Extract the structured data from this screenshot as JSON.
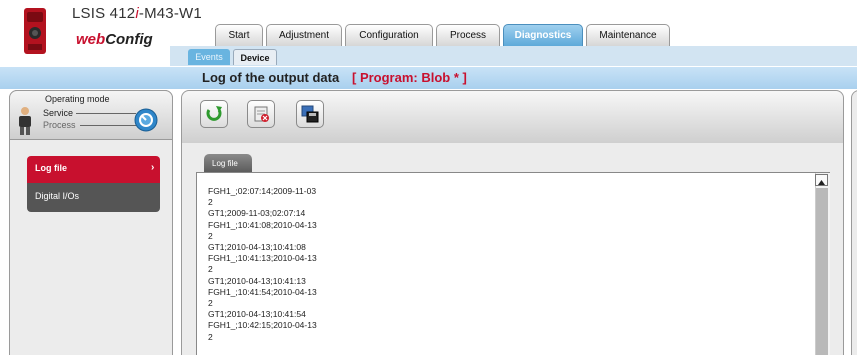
{
  "header": {
    "device_prefix": "LSIS 412",
    "device_italic": "i",
    "device_suffix": "-M43-W1",
    "brand_web": "web",
    "brand_config": "Config"
  },
  "main_tabs": [
    {
      "label": "Start"
    },
    {
      "label": "Adjustment"
    },
    {
      "label": "Configuration"
    },
    {
      "label": "Process"
    },
    {
      "label": "Diagnostics",
      "active": true
    },
    {
      "label": "Maintenance"
    }
  ],
  "sub_tabs": [
    {
      "label": "Events"
    },
    {
      "label": "Device",
      "active": true
    }
  ],
  "page": {
    "title": "Log of the output data",
    "program": "[ Program: Blob * ]"
  },
  "operating_mode": {
    "title": "Operating mode",
    "service": "Service",
    "process": "Process"
  },
  "nav": {
    "log_file": "Log file",
    "log_file_arrow": "›",
    "digital_ios": "Digital I/Os"
  },
  "log": {
    "tab_label": "Log file",
    "lines": [
      "FGH1_;02:07:14;2009-11-03",
      "2",
      "GT1;2009-11-03;02:07:14",
      "FGH1_;10:41:08;2010-04-13",
      "2",
      "GT1;2010-04-13;10:41:08",
      "FGH1_;10:41:13;2010-04-13",
      "2",
      "GT1;2010-04-13;10:41:13",
      "FGH1_;10:41:54;2010-04-13",
      "2",
      "GT1;2010-04-13;10:41:54",
      "FGH1_;10:42:15;2010-04-13",
      "2"
    ]
  },
  "colors": {
    "accent_red": "#c8102e",
    "active_tab_blue": "#5ea9d9",
    "titlebar_blue": "#a9d0ee"
  },
  "icons": {
    "toolbar": [
      "refresh-icon",
      "delete-log-icon",
      "save-to-disk-icon"
    ]
  }
}
